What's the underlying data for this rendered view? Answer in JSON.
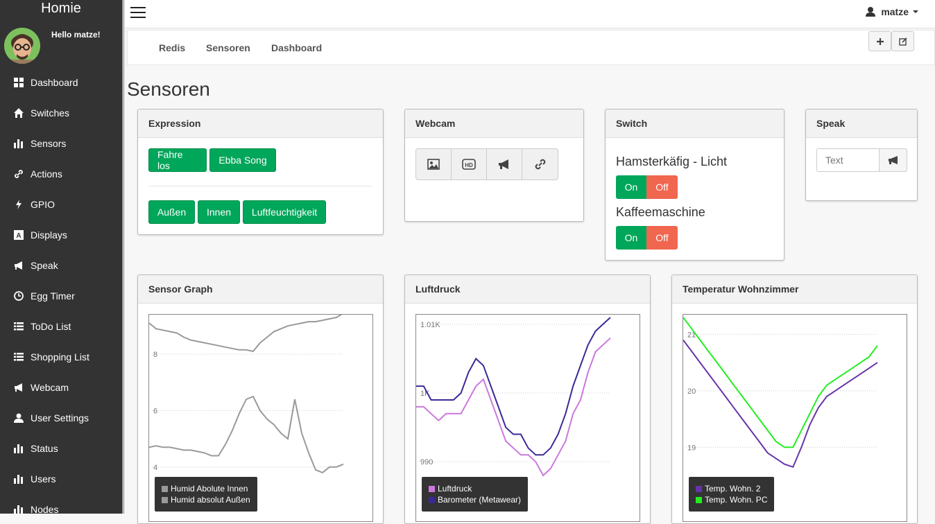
{
  "app": {
    "brand": "Homie",
    "greeting": "Hello matze!"
  },
  "user": {
    "name": "matze"
  },
  "nav": [
    {
      "label": "Dashboard",
      "icon": "dashboard-icon"
    },
    {
      "label": "Switches",
      "icon": "home-icon"
    },
    {
      "label": "Sensors",
      "icon": "bar-chart-icon"
    },
    {
      "label": "Actions",
      "icon": "link-icon"
    },
    {
      "label": "GPIO",
      "icon": "flash-icon"
    },
    {
      "label": "Displays",
      "icon": "font-icon"
    },
    {
      "label": "Speak",
      "icon": "bullhorn-icon"
    },
    {
      "label": "Egg Timer",
      "icon": "clock-icon"
    },
    {
      "label": "ToDo List",
      "icon": "list-icon"
    },
    {
      "label": "Shopping List",
      "icon": "list-icon"
    },
    {
      "label": "Webcam",
      "icon": "bullhorn-icon"
    },
    {
      "label": "User Settings",
      "icon": "user-icon"
    },
    {
      "label": "Status",
      "icon": "bar-chart-icon"
    },
    {
      "label": "Users",
      "icon": "bar-chart-icon"
    },
    {
      "label": "Nodes",
      "icon": "bar-chart-icon"
    }
  ],
  "tabs": [
    "Redis",
    "Sensoren",
    "Dashboard"
  ],
  "page_title": "Sensoren",
  "expression": {
    "title": "Expression",
    "row1": [
      "Fahre los",
      "Ebba Song"
    ],
    "row2": [
      "Außen",
      "Innen",
      "Luftfeuchtigkeit"
    ]
  },
  "webcam": {
    "title": "Webcam",
    "buttons": [
      "picture-icon",
      "hd-video-icon",
      "bullhorn-icon",
      "link-icon"
    ]
  },
  "switch": {
    "title": "Switch",
    "items": [
      {
        "label": "Hamsterkäfig - Licht",
        "on": "On",
        "off": "Off"
      },
      {
        "label": "Kaffeemaschine",
        "on": "On",
        "off": "Off"
      }
    ]
  },
  "speak": {
    "title": "Speak",
    "placeholder": "Text"
  },
  "graphs": {
    "sensor": {
      "title": "Sensor Graph",
      "ticks": [
        "8",
        "6",
        "4"
      ],
      "legend": [
        "Humid Abolute Innen",
        "Humid absolut Außen"
      ]
    },
    "luftdruck": {
      "title": "Luftdruck",
      "ticks": [
        "1.01K",
        "1K",
        "990"
      ],
      "legend": [
        "Luftdruck",
        "Barometer (Metawear)"
      ]
    },
    "temp": {
      "title": "Temperatur Wohnzimmer",
      "ticks": [
        "21",
        "20",
        "19"
      ],
      "legend": [
        "Temp. Wohn. 2",
        "Temp. Wohn. PC"
      ]
    }
  },
  "chart_data": [
    {
      "type": "line",
      "title": "Sensor Graph",
      "ylim": [
        3.7,
        9.3
      ],
      "series": [
        {
          "name": "Humid Abolute Innen",
          "color": "#999999",
          "values": [
            9.1,
            8.9,
            8.85,
            8.8,
            8.75,
            8.6,
            8.5,
            8.45,
            8.4,
            8.35,
            8.3,
            8.25,
            8.2,
            8.15,
            8.15,
            8.1,
            8.4,
            8.6,
            8.8,
            8.9,
            9.0,
            9.05,
            9.1,
            9.15,
            9.15,
            9.2,
            9.25,
            9.3,
            9.45
          ]
        },
        {
          "name": "Humid absolut Außen",
          "color": "#999999",
          "values": [
            4.7,
            4.75,
            4.7,
            4.7,
            4.65,
            4.6,
            4.6,
            4.55,
            4.5,
            4.4,
            4.4,
            4.8,
            5.3,
            5.9,
            6.4,
            6.5,
            6.0,
            5.7,
            5.5,
            5.2,
            5.0,
            6.4,
            5.2,
            4.5,
            3.9,
            3.8,
            4.0,
            4.0,
            4.1
          ]
        }
      ]
    },
    {
      "type": "line",
      "title": "Luftdruck",
      "ylim": [
        988,
        1011
      ],
      "series": [
        {
          "name": "Luftdruck",
          "color": "#cc77dd",
          "values": [
            998,
            998,
            997,
            996,
            997,
            997,
            997,
            999,
            1001,
            1002,
            999,
            996,
            993,
            992,
            991,
            991,
            990,
            988,
            989,
            991,
            993,
            997,
            999,
            1003,
            1006,
            1007,
            1008
          ]
        },
        {
          "name": "Barometer (Metawear)",
          "color": "#3a2a96",
          "values": [
            1001,
            1001,
            999,
            999,
            999,
            999,
            1000,
            1003,
            1005,
            1004,
            1001,
            998,
            995,
            994,
            994,
            992,
            991,
            991,
            992,
            994,
            997,
            1001,
            1004,
            1007,
            1009,
            1010,
            1011
          ]
        }
      ]
    },
    {
      "type": "line",
      "title": "Temperatur Wohnzimmer",
      "ylim": [
        18.5,
        21.3
      ],
      "series": [
        {
          "name": "Temp. Wohn. 2",
          "color": "#6633aa",
          "values": [
            20.9,
            20.7,
            20.5,
            20.3,
            20.1,
            19.9,
            19.7,
            19.5,
            19.3,
            19.1,
            18.9,
            18.8,
            18.7,
            18.65,
            19.0,
            19.4,
            19.7,
            19.9,
            20.0,
            20.1,
            20.2,
            20.3,
            20.4,
            20.5
          ]
        },
        {
          "name": "Temp. Wohn. PC",
          "color": "#22ee22",
          "values": [
            21.3,
            21.1,
            20.9,
            20.7,
            20.5,
            20.3,
            20.1,
            19.9,
            19.7,
            19.5,
            19.3,
            19.1,
            19.0,
            19.0,
            19.3,
            19.6,
            19.9,
            20.1,
            20.2,
            20.3,
            20.4,
            20.5,
            20.6,
            20.8
          ]
        }
      ]
    }
  ]
}
